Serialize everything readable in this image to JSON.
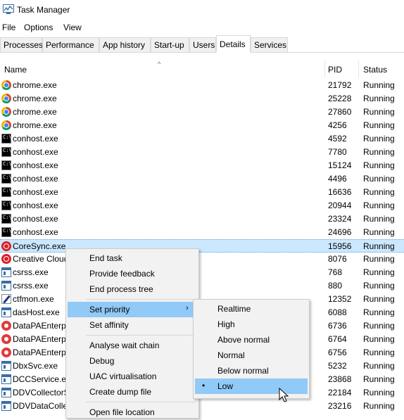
{
  "window": {
    "title": "Task Manager",
    "app_icon": "task-manager-icon"
  },
  "menubar": [
    "File",
    "Options",
    "View"
  ],
  "tabs": [
    "Processes",
    "Performance",
    "App history",
    "Start-up",
    "Users",
    "Details",
    "Services"
  ],
  "active_tab": "Details",
  "columns": {
    "name": "Name",
    "pid": "PID",
    "status": "Status"
  },
  "sort_indicator": "^",
  "processes": [
    {
      "name": "chrome.exe",
      "pid": "21792",
      "status": "Running",
      "icon": "chrome-icon"
    },
    {
      "name": "chrome.exe",
      "pid": "25228",
      "status": "Running",
      "icon": "chrome-icon"
    },
    {
      "name": "chrome.exe",
      "pid": "27860",
      "status": "Running",
      "icon": "chrome-icon"
    },
    {
      "name": "chrome.exe",
      "pid": "4256",
      "status": "Running",
      "icon": "chrome-icon"
    },
    {
      "name": "conhost.exe",
      "pid": "4592",
      "status": "Running",
      "icon": "console-icon"
    },
    {
      "name": "conhost.exe",
      "pid": "7780",
      "status": "Running",
      "icon": "console-icon"
    },
    {
      "name": "conhost.exe",
      "pid": "15124",
      "status": "Running",
      "icon": "console-icon"
    },
    {
      "name": "conhost.exe",
      "pid": "4496",
      "status": "Running",
      "icon": "console-icon"
    },
    {
      "name": "conhost.exe",
      "pid": "16636",
      "status": "Running",
      "icon": "console-icon"
    },
    {
      "name": "conhost.exe",
      "pid": "20944",
      "status": "Running",
      "icon": "console-icon"
    },
    {
      "name": "conhost.exe",
      "pid": "23324",
      "status": "Running",
      "icon": "console-icon"
    },
    {
      "name": "conhost.exe",
      "pid": "24696",
      "status": "Running",
      "icon": "console-icon"
    },
    {
      "name": "CoreSync.exe",
      "pid": "15956",
      "status": "Running",
      "icon": "creative-cloud-icon",
      "selected": true
    },
    {
      "name": "Creative Cloud",
      "pid": "8076",
      "status": "Running",
      "icon": "creative-cloud-icon"
    },
    {
      "name": "csrss.exe",
      "pid": "768",
      "status": "Running",
      "icon": "window-icon"
    },
    {
      "name": "csrss.exe",
      "pid": "880",
      "status": "Running",
      "icon": "window-icon"
    },
    {
      "name": "ctfmon.exe",
      "pid": "12352",
      "status": "Running",
      "icon": "pen-icon"
    },
    {
      "name": "dasHost.exe",
      "pid": "6088",
      "status": "Running",
      "icon": "window-icon"
    },
    {
      "name": "DataPAEnterp",
      "pid": "6736",
      "status": "Running",
      "icon": "gear-icon"
    },
    {
      "name": "DataPAEnterp",
      "pid": "6764",
      "status": "Running",
      "icon": "gear-icon"
    },
    {
      "name": "DataPAEnterp",
      "pid": "6756",
      "status": "Running",
      "icon": "gear-icon"
    },
    {
      "name": "DbxSvc.exe",
      "pid": "5232",
      "status": "Running",
      "icon": "window-icon"
    },
    {
      "name": "DCCService.ex",
      "pid": "23868",
      "status": "Running",
      "icon": "window-icon"
    },
    {
      "name": "DDVCollectorS",
      "pid": "22184",
      "status": "Running",
      "icon": "window-icon"
    },
    {
      "name": "DDVDataColle",
      "pid": "23216",
      "status": "Running",
      "icon": "window-icon"
    }
  ],
  "context_menu": {
    "items": [
      "End task",
      "Provide feedback",
      "End process tree",
      "Set priority",
      "Set affinity",
      "Analyse wait chain",
      "Debug",
      "UAC virtualisation",
      "Create dump file",
      "Open file location"
    ],
    "highlighted": "Set priority",
    "submenu_caret": "›"
  },
  "priority_submenu": {
    "items": [
      "Realtime",
      "High",
      "Above normal",
      "Normal",
      "Below normal",
      "Low"
    ],
    "selected": "Low",
    "bullet": "•"
  },
  "colors": {
    "selection": "#cce8ff",
    "menu_highlight": "#91c9f7",
    "menu_bg": "#f2f2f2"
  }
}
